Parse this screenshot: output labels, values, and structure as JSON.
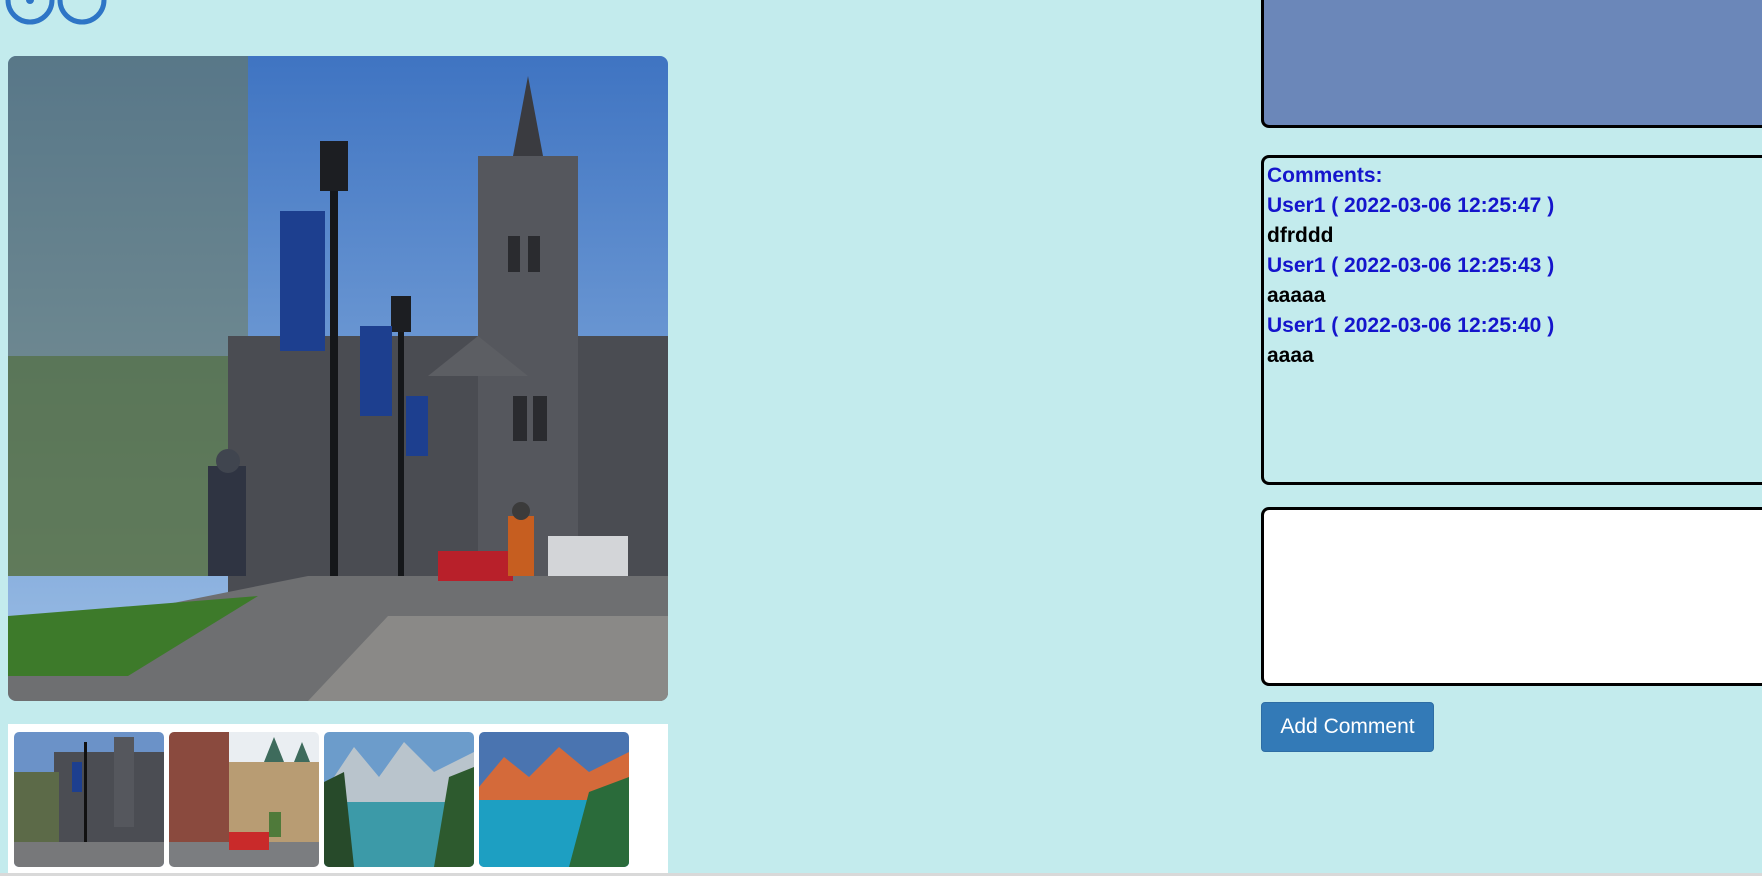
{
  "icons": {
    "logo": "logo-icon"
  },
  "colors": {
    "background": "#c3ebed",
    "description_box": "#6b87b9",
    "comment_author": "#1515cc",
    "button": "#337ab7"
  },
  "gallery": {
    "main_image": "University of Toronto campus street with lamp posts, banners and stone building",
    "thumbnails": [
      {
        "name": "University of Toronto"
      },
      {
        "name": "City street with red bus"
      },
      {
        "name": "Mountain lake with forest"
      },
      {
        "name": "Turquoise lake at sunset"
      }
    ]
  },
  "comments": {
    "title": "Comments:",
    "items": [
      {
        "author": "User1 ( 2022-03-06 12:25:47 )",
        "text": "dfrddd"
      },
      {
        "author": "User1 ( 2022-03-06 12:25:43 )",
        "text": "aaaaa"
      },
      {
        "author": "User1 ( 2022-03-06 12:25:40 )",
        "text": "aaaa"
      }
    ]
  },
  "comment_form": {
    "input_value": "",
    "submit_label": "Add Comment"
  }
}
